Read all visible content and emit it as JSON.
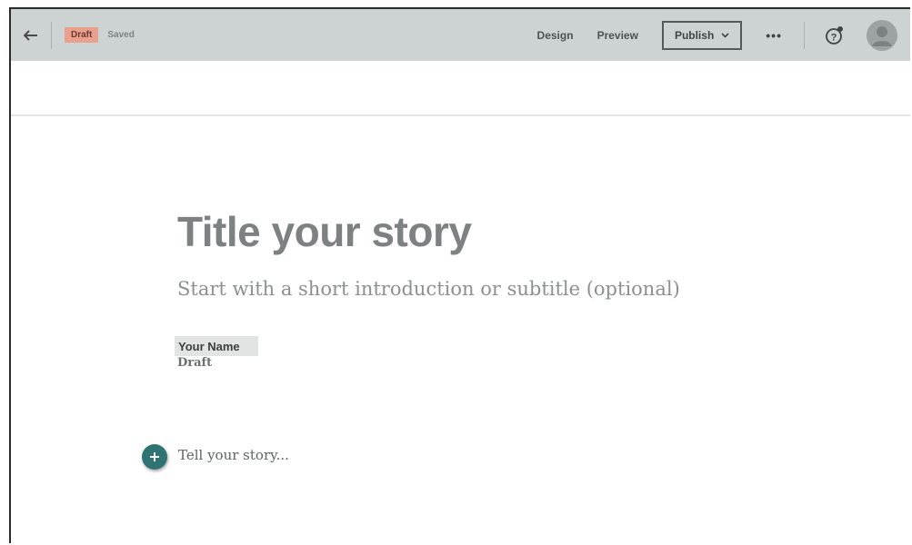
{
  "topbar": {
    "back_icon": "arrow-left-icon",
    "draft_badge": "Draft",
    "saved_status": "Saved",
    "design_label": "Design",
    "preview_label": "Preview",
    "publish_label": "Publish",
    "more_label": "•••",
    "help_icon": "help-icon",
    "avatar_icon": "user-avatar-icon"
  },
  "story": {
    "title_placeholder": "Title your story",
    "subtitle_placeholder": "Start with a short introduction or subtitle (optional)",
    "author_name": "Your Name",
    "author_status": "Draft",
    "body_placeholder": "Tell your story..."
  },
  "colors": {
    "topbar_bg": "#cdd3d3",
    "draft_badge_bg": "#e9a08c",
    "accent_teal": "#2f7472"
  }
}
